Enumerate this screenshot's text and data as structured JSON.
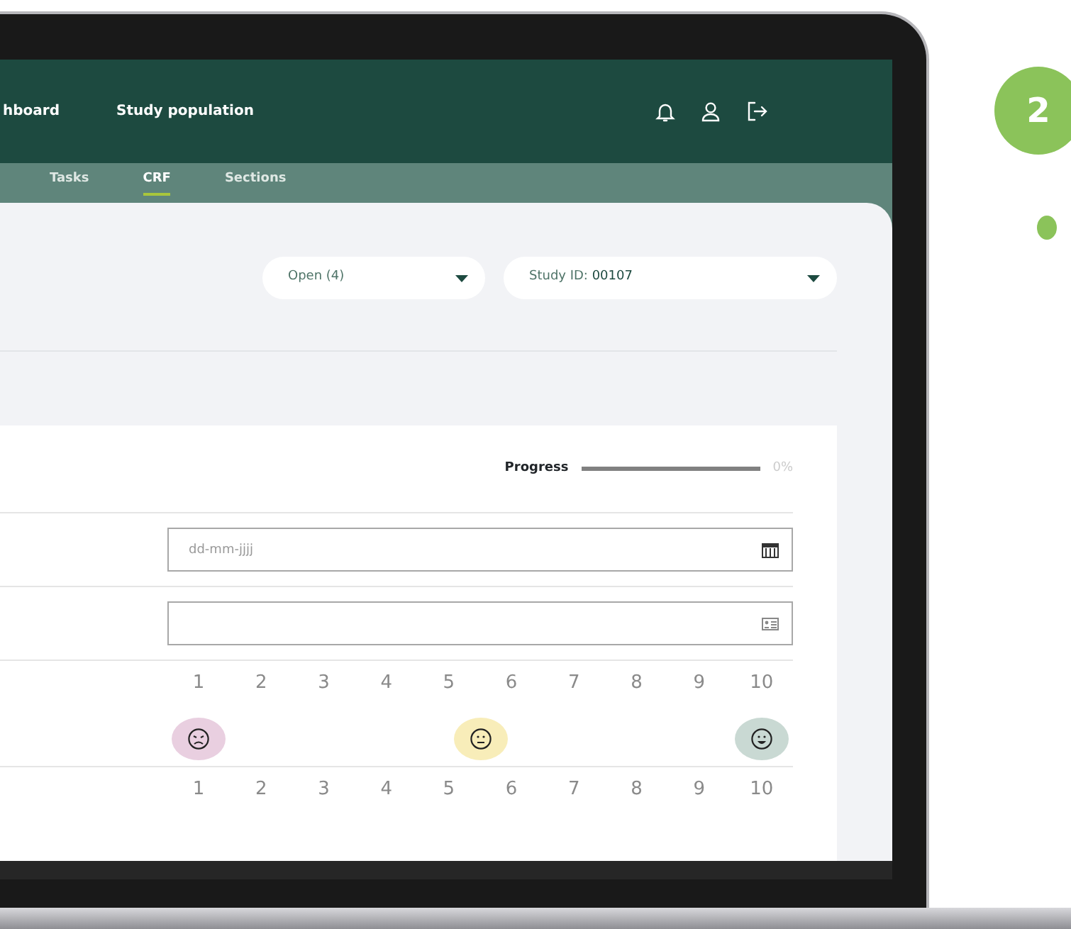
{
  "header": {
    "nav": [
      {
        "label": "hboard"
      },
      {
        "label": "Study population"
      }
    ]
  },
  "subnav": [
    {
      "label": "Tasks",
      "selected": false
    },
    {
      "label": "CRF",
      "selected": true
    },
    {
      "label": "Sections",
      "selected": false
    }
  ],
  "filters": [
    {
      "kind": "status",
      "label": "Open (4)"
    },
    {
      "kind": "study",
      "label": "Study ID:",
      "value": "00107"
    }
  ],
  "progress": {
    "label": "Progress",
    "reading": "0%"
  },
  "fields": [
    {
      "kind": "date",
      "placeholder": "dd-mm-jjjj"
    },
    {
      "kind": "id"
    }
  ],
  "scales": [
    {
      "numbers": [
        "1",
        "2",
        "3",
        "4",
        "5",
        "6",
        "7",
        "8",
        "9",
        "10"
      ],
      "faces": [
        {
          "kind": "sad",
          "color": "#e9cfe0"
        },
        {
          "kind": "neutral",
          "color": "#f8edb9"
        },
        {
          "kind": "happy",
          "color": "#c9d9d3"
        }
      ]
    },
    {
      "numbers": [
        "1",
        "2",
        "3",
        "4",
        "5",
        "6",
        "7",
        "8",
        "9",
        "10"
      ]
    }
  ],
  "step": {
    "number": "2"
  }
}
